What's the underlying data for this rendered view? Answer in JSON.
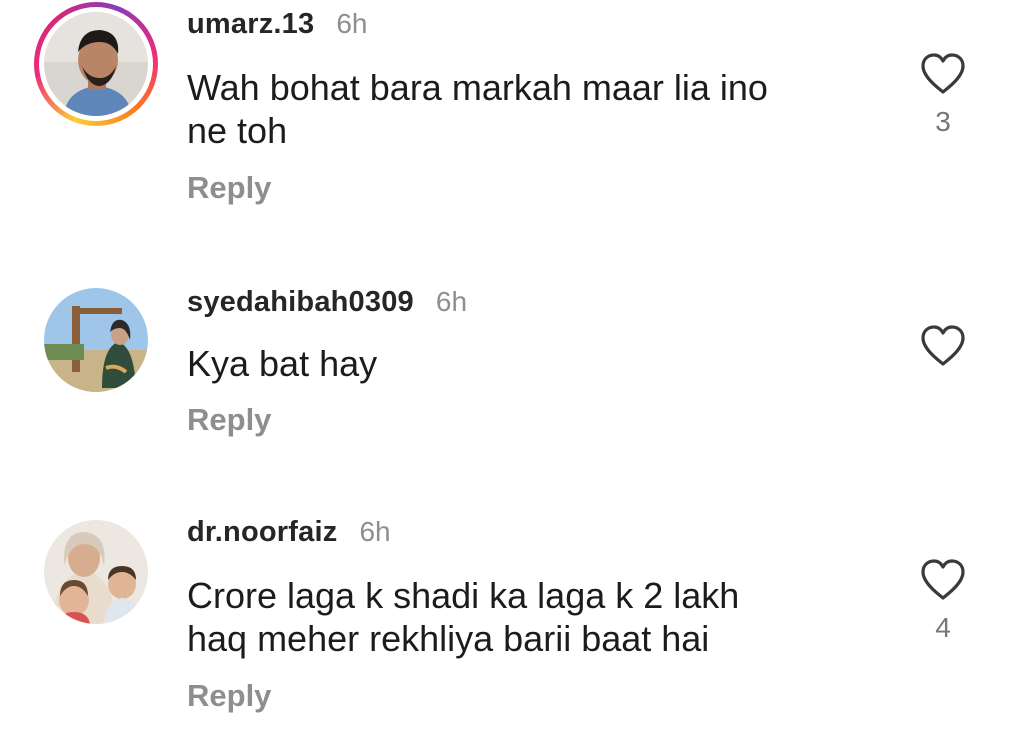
{
  "comments": [
    {
      "username": "umarz.13",
      "time": "6h",
      "text_lines": [
        "Wah bohat bara markah maar lia ino",
        "ne toh"
      ],
      "reply_label": "Reply",
      "likes": "3",
      "has_story": true
    },
    {
      "username": "syedahibah0309",
      "time": "6h",
      "text_lines": [
        "Kya bat hay"
      ],
      "reply_label": "Reply",
      "likes": "",
      "has_story": false
    },
    {
      "username": "dr.noorfaiz",
      "time": "6h",
      "text_lines": [
        "Crore laga k shadi ka laga k 2 lakh",
        "haq meher rekhliya barii baat hai"
      ],
      "reply_label": "Reply",
      "likes": "4",
      "has_story": false
    }
  ],
  "icons": {
    "like": "heart-outline-icon"
  },
  "colors": {
    "username": "#262626",
    "muted": "#8e8e8e",
    "story_gradient": [
      "#f9ce34",
      "#ee2a7b",
      "#8a3ab9"
    ]
  }
}
